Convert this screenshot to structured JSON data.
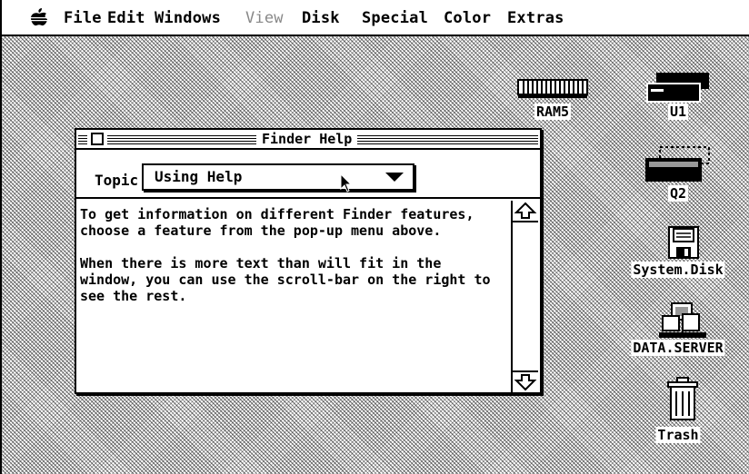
{
  "menubar": {
    "items": [
      "File",
      "Edit",
      "Windows",
      "View",
      "Disk",
      "Special",
      "Color",
      "Extras"
    ]
  },
  "desktop": {
    "icons": [
      {
        "name": "RAM5"
      },
      {
        "name": "U1"
      },
      {
        "name": "Q2"
      },
      {
        "name": "System.Disk"
      },
      {
        "name": "DATA.SERVER"
      },
      {
        "name": "Trash"
      }
    ]
  },
  "window": {
    "title": "Finder Help",
    "topic_label": "Topic",
    "topic_value": "Using Help",
    "help_text": "To get information on different Finder features,\nchoose a feature from the pop-up menu above.\n\nWhen there is more text than will fit in the\nwindow, you can use the scroll-bar on the right to\nsee the rest."
  }
}
